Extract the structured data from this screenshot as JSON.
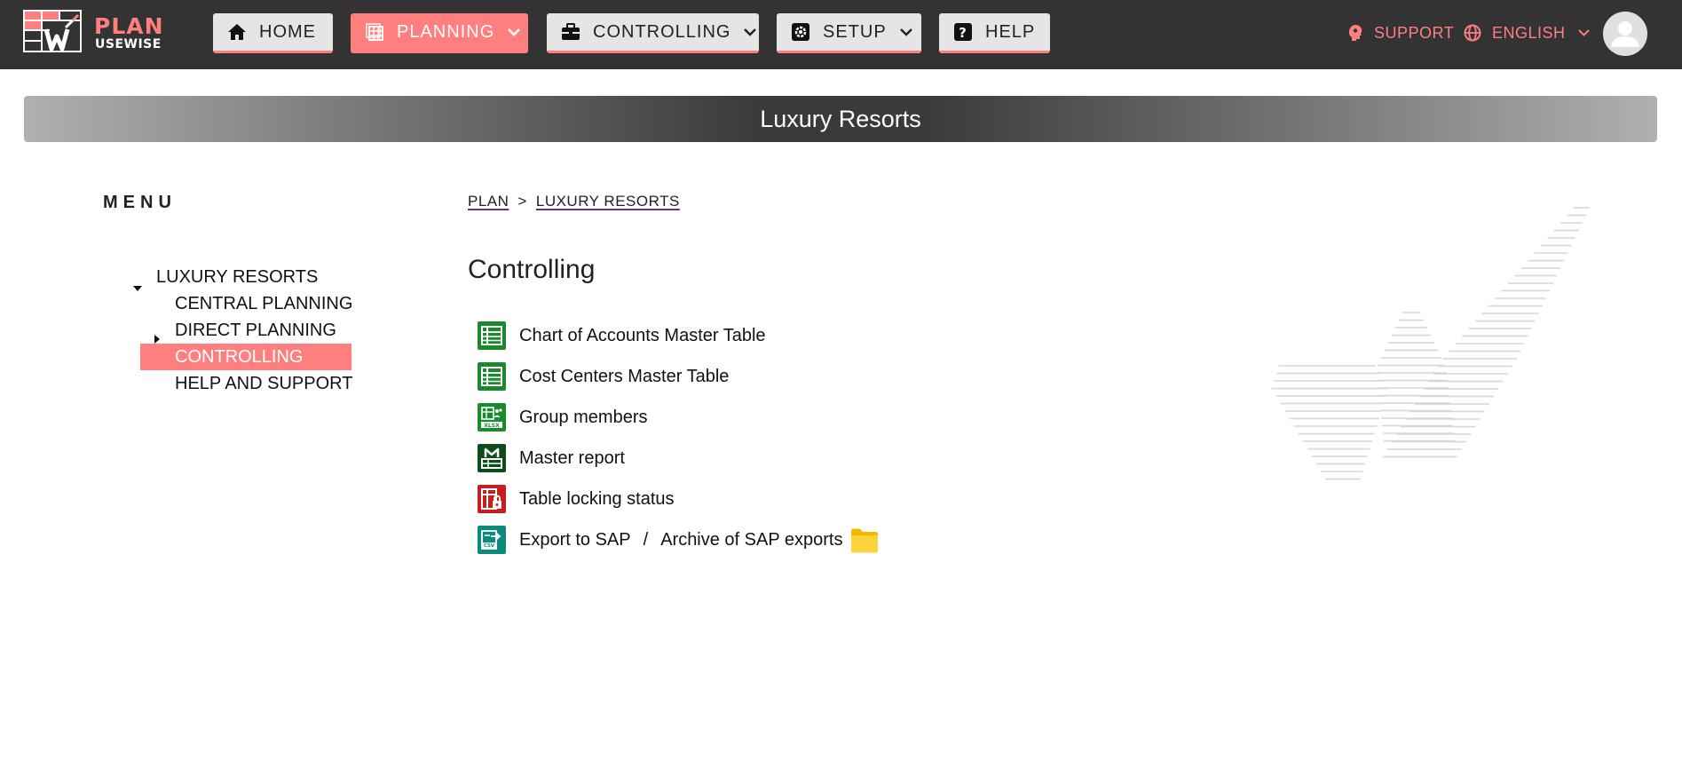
{
  "app": {
    "logo_primary": "PLAN",
    "logo_secondary": "USEWISE"
  },
  "nav": {
    "home": {
      "label": "HOME",
      "icon": "home-icon"
    },
    "planning": {
      "label": "PLANNING",
      "icon": "calendar-grid-icon",
      "active": true
    },
    "controlling": {
      "label": "CONTROLLING",
      "icon": "briefcase-icon"
    },
    "setup": {
      "label": "SETUP",
      "icon": "gear-icon"
    },
    "help": {
      "label": "HELP",
      "icon": "question-icon"
    }
  },
  "topright": {
    "support_label": "SUPPORT",
    "language_label": "ENGLISH"
  },
  "banner": {
    "title": "Luxury Resorts"
  },
  "menu": {
    "title": "MENU",
    "items": [
      {
        "label": "LUXURY RESORTS",
        "expanded": true
      },
      {
        "label": "CENTRAL PLANNING"
      },
      {
        "label": "DIRECT PLANNING",
        "collapsed": true
      },
      {
        "label": "CONTROLLING",
        "active": true
      },
      {
        "label": "HELP AND SUPPORT"
      }
    ]
  },
  "breadcrumb": {
    "items": [
      "PLAN",
      "LUXURY RESORTS"
    ],
    "separator": ">"
  },
  "main": {
    "title": "Controlling",
    "links": [
      {
        "label": "Chart of Accounts Master Table",
        "icon": "table-icon",
        "color": "#1b8a2e"
      },
      {
        "label": "Cost Centers Master Table",
        "icon": "table-icon",
        "color": "#1b8a2e"
      },
      {
        "label": "Group members",
        "icon": "xlsx-group-icon",
        "color": "#1b8a2e"
      },
      {
        "label": "Master report",
        "icon": "report-m-icon",
        "color": "#0d4d1c"
      },
      {
        "label": "Table locking status",
        "icon": "table-lock-icon",
        "color": "#c81d1d"
      },
      {
        "label": "Export to SAP",
        "label2": "Archive of SAP exports",
        "separator": "/",
        "icon": "csv-export-icon",
        "color": "#0e8a7a",
        "extra_icon": "folder-icon"
      }
    ]
  },
  "colors": {
    "topbar": "#333333",
    "accent": "#ff7f7f",
    "nav_button": "#e5e5e5"
  }
}
